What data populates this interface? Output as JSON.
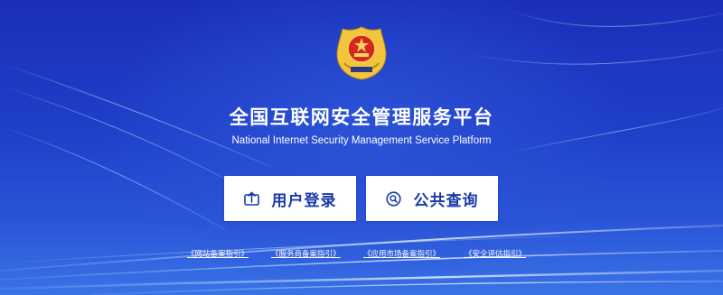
{
  "colors": {
    "background_top": "#1a2fb8",
    "background_bottom": "#3a73e6",
    "button_bg": "#ffffff",
    "button_text": "#1a3aa8",
    "emblem_gold": "#f2c53d",
    "emblem_red": "#d4281f"
  },
  "header": {
    "emblem_icon": "police-emblem-icon",
    "title_cn": "全国互联网安全管理服务平台",
    "title_en": "National Internet Security Management Service Platform"
  },
  "actions": {
    "login": {
      "label": "用户登录",
      "icon": "upload-login-icon"
    },
    "search": {
      "label": "公共查询",
      "icon": "search-icon"
    }
  },
  "guides": [
    {
      "label": "《网站备案指引》"
    },
    {
      "label": "《服务商备案指引》"
    },
    {
      "label": "《应用市场备案指引》"
    },
    {
      "label": "《安全评估指引》"
    }
  ]
}
